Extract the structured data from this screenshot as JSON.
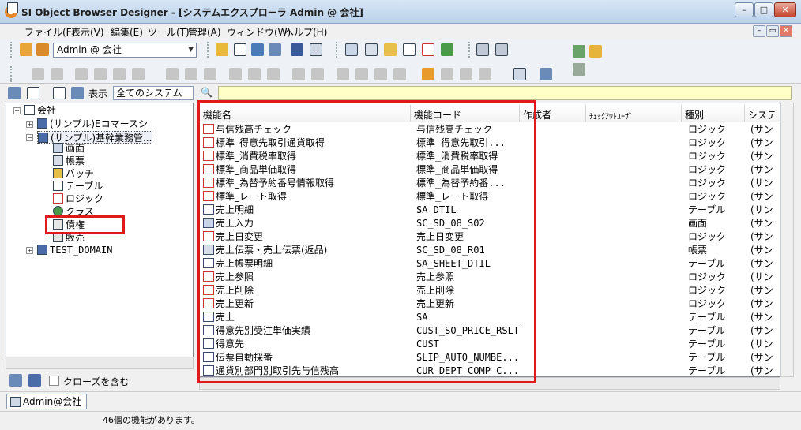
{
  "window": {
    "title": "SI Object Browser Designer - [システムエクスプローラ Admin @ 会社]",
    "app_icon_glyph": "S",
    "controls": {
      "minimize": "–",
      "maximize": "□",
      "close": "✕"
    }
  },
  "menu": {
    "items": [
      "ファイル(F)",
      "表示(V)",
      "編集(E)",
      "ツール(T)",
      "管理(A)",
      "ウィンドウ(W)",
      "ヘルプ(H)"
    ]
  },
  "toolbar": {
    "user_combo": "Admin @ 会社"
  },
  "filter": {
    "display_label": "表示",
    "display_value": "全てのシステム",
    "search_icon": "binoculars-icon"
  },
  "tree": {
    "nodes": [
      {
        "label": "会社",
        "icon": "company-icon"
      },
      {
        "label": "(サンプル)Eコマースシ",
        "icon": "system-icon"
      },
      {
        "label": "(サンプル)基幹業務管...",
        "icon": "system-icon"
      },
      {
        "label": "画面",
        "icon": "screen-icon"
      },
      {
        "label": "帳票",
        "icon": "report-icon"
      },
      {
        "label": "バッチ",
        "icon": "batch-icon"
      },
      {
        "label": "テーブル",
        "icon": "table-icon"
      },
      {
        "label": "ロジック",
        "icon": "logic-icon"
      },
      {
        "label": "クラス",
        "icon": "class-icon"
      },
      {
        "label": "債権",
        "icon": "folder-icon"
      },
      {
        "label": "販売",
        "icon": "folder-icon"
      },
      {
        "label": "TEST_DOMAIN",
        "icon": "domain-icon"
      }
    ]
  },
  "tree_footer": {
    "closed_label": "クローズを含む"
  },
  "list": {
    "columns": [
      "機能名",
      "機能コード",
      "作成者",
      "ﾁｪｯｸｱｳﾄﾕｰｻﾞ",
      "種別",
      "システ"
    ],
    "rows": [
      {
        "name": "与信残高チェック",
        "code": "与信残高チェック",
        "type": "ロジック",
        "system": "(サン",
        "icon": "logic"
      },
      {
        "name": "標準_得意先取引通貨取得",
        "code": "標準_得意先取引...",
        "type": "ロジック",
        "system": "(サン",
        "icon": "logic"
      },
      {
        "name": "標準_消費税率取得",
        "code": "標準_消費税率取得",
        "type": "ロジック",
        "system": "(サン",
        "icon": "logic"
      },
      {
        "name": "標準_商品単価取得",
        "code": "標準_商品単価取得",
        "type": "ロジック",
        "system": "(サン",
        "icon": "logic"
      },
      {
        "name": "標準_為替予約番号情報取得",
        "code": "標準_為替予約番...",
        "type": "ロジック",
        "system": "(サン",
        "icon": "logic"
      },
      {
        "name": "標準_レート取得",
        "code": "標準_レート取得",
        "type": "ロジック",
        "system": "(サン",
        "icon": "logic"
      },
      {
        "name": "売上明細",
        "code": "SA_DTIL",
        "type": "テーブル",
        "system": "(サン",
        "icon": "table"
      },
      {
        "name": "売上入力",
        "code": "SC_SD_08_S02",
        "type": "画面",
        "system": "(サン",
        "icon": "screen"
      },
      {
        "name": "売上日変更",
        "code": "売上日変更",
        "type": "ロジック",
        "system": "(サン",
        "icon": "logic"
      },
      {
        "name": "売上伝票・売上伝票(返品)",
        "code": "SC_SD_08_R01",
        "type": "帳票",
        "system": "(サン",
        "icon": "report"
      },
      {
        "name": "売上帳票明細",
        "code": "SA_SHEET_DTIL",
        "type": "テーブル",
        "system": "(サン",
        "icon": "table"
      },
      {
        "name": "売上参照",
        "code": "売上参照",
        "type": "ロジック",
        "system": "(サン",
        "icon": "logic"
      },
      {
        "name": "売上削除",
        "code": "売上削除",
        "type": "ロジック",
        "system": "(サン",
        "icon": "logic"
      },
      {
        "name": "売上更新",
        "code": "売上更新",
        "type": "ロジック",
        "system": "(サン",
        "icon": "logic"
      },
      {
        "name": "売上",
        "code": "SA",
        "type": "テーブル",
        "system": "(サン",
        "icon": "table"
      },
      {
        "name": "得意先別受注単価実績",
        "code": "CUST_SO_PRICE_RSLT",
        "type": "テーブル",
        "system": "(サン",
        "icon": "table"
      },
      {
        "name": "得意先",
        "code": "CUST",
        "type": "テーブル",
        "system": "(サン",
        "icon": "table"
      },
      {
        "name": "伝票自動採番",
        "code": "SLIP_AUTO_NUMBE...",
        "type": "テーブル",
        "system": "(サン",
        "icon": "table"
      },
      {
        "name": "通貨別部門別取引先与信残高",
        "code": "CUR_DEPT_COMP_C...",
        "type": "テーブル",
        "system": "(サン",
        "icon": "table"
      }
    ]
  },
  "tabs": {
    "doc_tab": "Admin@会社"
  },
  "status": {
    "message": "46個の機能があります。"
  }
}
